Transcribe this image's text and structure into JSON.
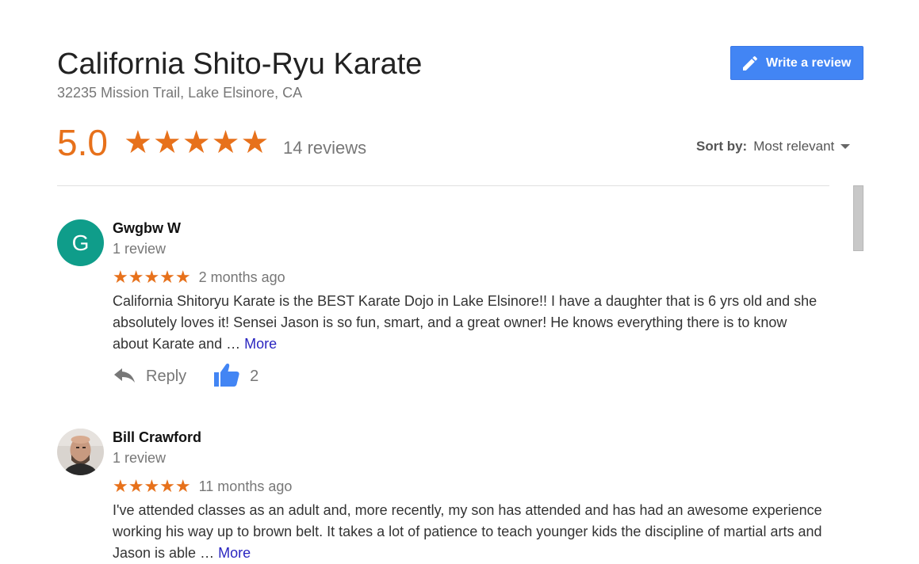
{
  "business": {
    "name": "California Shito-Ryu Karate",
    "address": "32235 Mission Trail, Lake Elsinore, CA",
    "rating": "5.0",
    "stars": "★★★★★",
    "review_count": "14 reviews"
  },
  "write_review": {
    "label": "Write a review",
    "icon": "pencil-icon",
    "color": "#4285f4"
  },
  "sort": {
    "label": "Sort by:",
    "value": "Most relevant"
  },
  "colors": {
    "star": "#e7711b",
    "link": "#2a25c0",
    "avatar_bg": "#0f9d8a"
  },
  "reviews": [
    {
      "avatar_letter": "G",
      "name": "Gwgbw W",
      "count": "1 review",
      "stars": "★★★★★",
      "time": "2 months ago",
      "text": "California Shitoryu Karate is the BEST Karate Dojo in Lake Elsinore!! I have a daughter that is 6 yrs old and she absolutely loves it! Sensei Jason is so fun, smart, and a great owner! He knows everything there is to know about Karate and … ",
      "more": "More",
      "reply": "Reply",
      "likes": "2"
    },
    {
      "avatar_letter": "",
      "name": "Bill Crawford",
      "count": "1 review",
      "stars": "★★★★★",
      "time": "11 months ago",
      "text": "I've attended classes as an adult and, more recently, my son has attended and has had an awesome experience working his way up to brown belt.  It takes a lot of patience to teach younger kids the discipline of martial arts and Jason is able … ",
      "more": "More"
    }
  ]
}
